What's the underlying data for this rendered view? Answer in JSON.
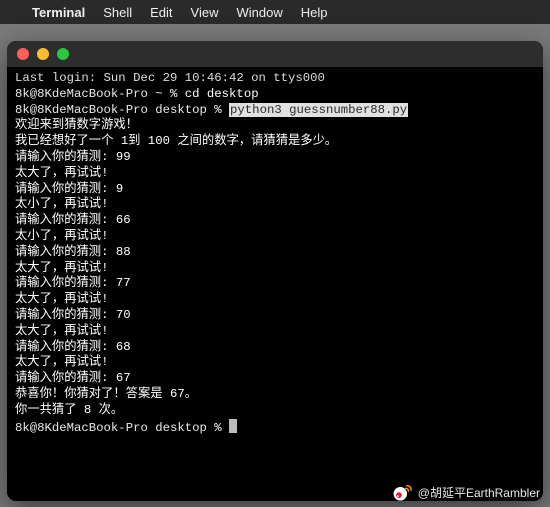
{
  "menubar": {
    "apple": "",
    "app": "Terminal",
    "items": [
      "Shell",
      "Edit",
      "View",
      "Window",
      "Help"
    ]
  },
  "terminal": {
    "login_line": "Last login: Sun Dec 29 10:46:42 on ttys000",
    "user": "8k@8KdeMacBook-Pro",
    "home_path": "~",
    "desktop_path": "desktop",
    "sigil": "%",
    "cmd_cd": "cd desktop",
    "cmd_run": "python3 guessnumber88.py",
    "output": {
      "welcome": "欢迎来到猜数字游戏！",
      "intro": "我已经想好了一个 1到 100 之间的数字，请猜猜是多少。",
      "prompt_label": "请输入你的猜测:",
      "too_big": "太大了，再试试!",
      "too_small": "太小了，再试试!",
      "congrats": "恭喜你！你猜对了！答案是 67。",
      "total": "你一共猜了 8 次。",
      "guesses": [
        {
          "value": "99",
          "feedback": "too_big"
        },
        {
          "value": "9",
          "feedback": "too_small"
        },
        {
          "value": "66",
          "feedback": "too_small"
        },
        {
          "value": "88",
          "feedback": "too_big"
        },
        {
          "value": "77",
          "feedback": "too_big"
        },
        {
          "value": "70",
          "feedback": "too_big"
        },
        {
          "value": "68",
          "feedback": "too_big"
        },
        {
          "value": "67",
          "feedback": "correct"
        }
      ]
    }
  },
  "watermark": {
    "handle": "@胡延平EarthRambler"
  }
}
